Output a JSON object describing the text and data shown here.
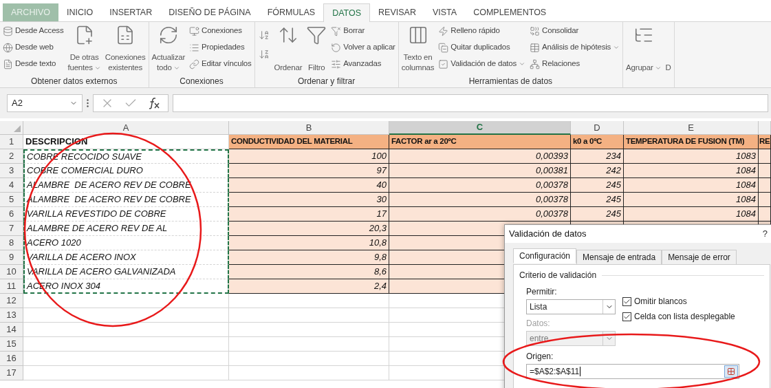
{
  "ribbon_tabs": [
    {
      "label": "ARCHIVO",
      "kind": "file",
      "selected": false
    },
    {
      "label": "INICIO",
      "kind": "tab",
      "selected": false
    },
    {
      "label": "INSERTAR",
      "kind": "tab",
      "selected": false
    },
    {
      "label": "DISEÑO DE PÁGINA",
      "kind": "tab",
      "selected": false
    },
    {
      "label": "FÓRMULAS",
      "kind": "tab",
      "selected": false
    },
    {
      "label": "DATOS",
      "kind": "tab",
      "selected": true
    },
    {
      "label": "REVISAR",
      "kind": "tab",
      "selected": false
    },
    {
      "label": "VISTA",
      "kind": "tab",
      "selected": false
    },
    {
      "label": "COMPLEMENTOS",
      "kind": "tab",
      "selected": false
    }
  ],
  "ribbon_groups": [
    {
      "title": "Obtener datos externos",
      "columns": [
        {
          "kind": "stack",
          "items": [
            {
              "label": "Desde Access"
            },
            {
              "label": "Desde web"
            },
            {
              "label": "Desde texto"
            }
          ]
        },
        {
          "kind": "large",
          "label_lines": [
            "De otras",
            "fuentes"
          ],
          "dropdown": true
        },
        {
          "kind": "large",
          "label_lines": [
            "Conexiones",
            "existentes"
          ],
          "dropdown": false
        }
      ]
    },
    {
      "title": "Conexiones",
      "columns": [
        {
          "kind": "large",
          "label_lines": [
            "Actualizar",
            "todo"
          ],
          "dropdown": true
        },
        {
          "kind": "stack",
          "items": [
            {
              "label": "Conexiones"
            },
            {
              "label": "Propiedades"
            },
            {
              "label": "Editar vínculos"
            }
          ]
        }
      ]
    },
    {
      "title": "Ordenar y filtrar",
      "columns": [
        {
          "kind": "icons"
        },
        {
          "kind": "large",
          "label_lines": [
            "Ordenar"
          ],
          "dropdown": false
        },
        {
          "kind": "large",
          "label_lines": [
            "Filtro"
          ],
          "dropdown": false
        },
        {
          "kind": "stack",
          "items": [
            {
              "label": "Borrar"
            },
            {
              "label": "Volver a aplicar"
            },
            {
              "label": "Avanzadas"
            }
          ]
        }
      ]
    },
    {
      "title": "Herramientas de datos",
      "columns": [
        {
          "kind": "large",
          "label_lines": [
            "Texto en",
            "columnas"
          ],
          "dropdown": false
        },
        {
          "kind": "stack",
          "items": [
            {
              "label": "Relleno rápido",
              "dropdown": false
            },
            {
              "label": "Quitar duplicados",
              "dropdown": false
            },
            {
              "label": "Validación de datos",
              "dropdown": true
            }
          ]
        },
        {
          "kind": "stack",
          "items": [
            {
              "label": "Consolidar",
              "dropdown": false
            },
            {
              "label": "Análisis de hipótesis",
              "dropdown": true
            },
            {
              "label": "Relaciones",
              "dropdown": false
            }
          ]
        }
      ]
    },
    {
      "columns": [
        {
          "kind": "large",
          "label_lines": [
            "Agrupar"
          ],
          "dropdown": true
        },
        {
          "kind": "large",
          "label_lines": [
            "D"
          ],
          "dropdown": false
        }
      ]
    }
  ],
  "formula_bar": {
    "name_box": "A2"
  },
  "sheet": {
    "columns": [
      {
        "letter": "A",
        "selected": false
      },
      {
        "letter": "B",
        "selected": false
      },
      {
        "letter": "C",
        "selected": true
      },
      {
        "letter": "D",
        "selected": false
      },
      {
        "letter": "E",
        "selected": false
      },
      {
        "selected": false
      }
    ],
    "rows": [
      {
        "number": "1",
        "kind": "header",
        "in_copy_range": false,
        "cells": [
          "DESCRIPCION",
          "CONDUCTIVIDAD DEL MATERIAL",
          "FACTOR ar a 20ºC",
          "k0 a 0ºC",
          "TEMPERATURA DE FUSION (TM)",
          "RE"
        ]
      },
      {
        "number": "2",
        "kind": "data",
        "in_copy_range": true,
        "cells": [
          "COBRE RECOCIDO SUAVE",
          "100",
          "0,00393",
          "234",
          "1083",
          null
        ]
      },
      {
        "number": "3",
        "kind": "data",
        "in_copy_range": true,
        "cells": [
          "COBRE COMERCIAL DURO",
          "97",
          "0,00381",
          "242",
          "1084",
          null
        ]
      },
      {
        "number": "4",
        "kind": "data",
        "in_copy_range": true,
        "cells": [
          "ALAMBRE  DE ACERO REV DE COBRE",
          "40",
          "0,00378",
          "245",
          "1084",
          null
        ]
      },
      {
        "number": "5",
        "kind": "data",
        "in_copy_range": true,
        "cells": [
          "ALAMBRE  DE ACERO REV DE COBRE",
          "30",
          "0,00378",
          "245",
          "1084",
          null
        ]
      },
      {
        "number": "6",
        "kind": "data",
        "in_copy_range": true,
        "cells": [
          "VARILLA REVESTIDO DE COBRE",
          "17",
          "0,00378",
          "245",
          "1084",
          null
        ]
      },
      {
        "number": "7",
        "kind": "data",
        "in_copy_range": true,
        "cells": [
          "ALAMBRE DE ACERO REV DE AL",
          "20,3",
          null,
          null,
          null,
          null
        ]
      },
      {
        "number": "8",
        "kind": "data",
        "in_copy_range": true,
        "cells": [
          "ACERO 1020",
          "10,8",
          null,
          null,
          null,
          null
        ]
      },
      {
        "number": "9",
        "kind": "data",
        "in_copy_range": true,
        "cells": [
          "VARILLA DE ACERO INOX",
          "9,8",
          null,
          null,
          null,
          null
        ]
      },
      {
        "number": "10",
        "kind": "data",
        "in_copy_range": true,
        "cells": [
          "VARILLA DE ACERO GALVANIZADA",
          "8,6",
          null,
          null,
          null,
          null
        ]
      },
      {
        "number": "11",
        "kind": "data",
        "in_copy_range": true,
        "cells": [
          "ACERO INOX 304",
          "2,4",
          null,
          null,
          null,
          null
        ]
      },
      {
        "number": "12",
        "kind": "empty",
        "in_copy_range": false
      },
      {
        "number": "13",
        "kind": "empty",
        "in_copy_range": false
      },
      {
        "number": "14",
        "kind": "empty",
        "in_copy_range": false
      },
      {
        "number": "15",
        "kind": "empty",
        "in_copy_range": false
      },
      {
        "number": "16",
        "kind": "empty",
        "in_copy_range": false
      },
      {
        "number": "17",
        "kind": "empty",
        "in_copy_range": false
      }
    ]
  },
  "dialog": {
    "title": "Validación de datos",
    "help": "?",
    "tabs": [
      {
        "label": "Configuración",
        "selected": true
      },
      {
        "label": "Mensaje de entrada",
        "selected": false
      },
      {
        "label": "Mensaje de error",
        "selected": false
      }
    ],
    "section": "Criterio de validación",
    "allow": {
      "label": "Permitir:",
      "value": "Lista",
      "disabled": false
    },
    "checkboxes": [
      {
        "label": "Omitir blancos",
        "checked": true
      },
      {
        "label": "Celda con lista desplegable",
        "checked": true
      }
    ],
    "data": {
      "label": "Datos:",
      "value": "entre",
      "disabled": true
    },
    "source": {
      "label": "Origen:",
      "value": "=$A$2:$A$11"
    }
  }
}
